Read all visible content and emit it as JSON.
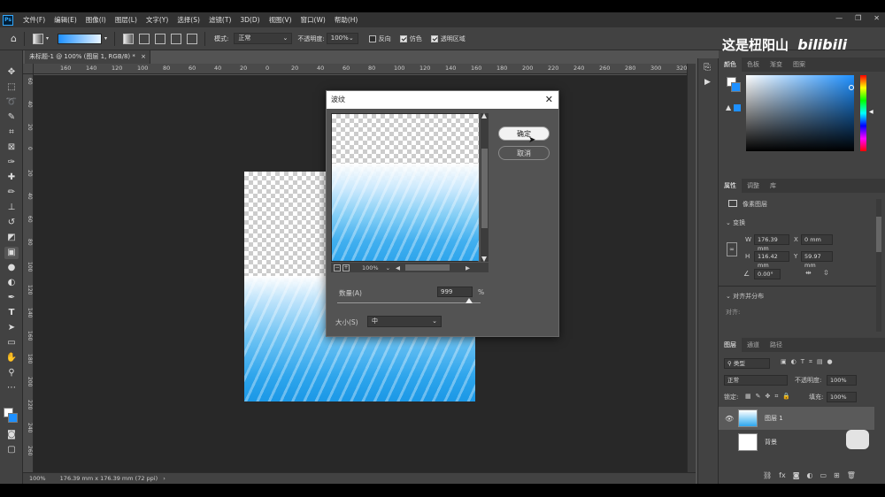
{
  "menubar": {
    "logo": "Ps",
    "items": [
      "文件(F)",
      "编辑(E)",
      "图像(I)",
      "图层(L)",
      "文字(Y)",
      "选择(S)",
      "滤镜(T)",
      "3D(D)",
      "视图(V)",
      "窗口(W)",
      "帮助(H)"
    ],
    "window_controls": [
      "—",
      "❐",
      "✕"
    ]
  },
  "optionsbar": {
    "mode_label": "模式:",
    "mode_value": "正常",
    "opacity_label": "不透明度:",
    "opacity_value": "100%",
    "reverse_label": "反向",
    "dither_label": "仿色",
    "transparency_label": "透明区域",
    "reverse_checked": false,
    "dither_checked": true,
    "transparency_checked": true
  },
  "document": {
    "tab_title": "未标题-1 @ 100% (图层 1, RGB/8) *",
    "tab_close": "×",
    "ruler_top_labels": [
      "160",
      "140",
      "120",
      "100",
      "80",
      "60",
      "40",
      "20",
      "0",
      "20",
      "40",
      "60",
      "80",
      "100",
      "120",
      "140",
      "160",
      "180",
      "200",
      "220",
      "240",
      "260",
      "280",
      "300",
      "320"
    ],
    "ruler_left_labels": [
      "60",
      "40",
      "20",
      "0",
      "20",
      "40",
      "60",
      "80",
      "100",
      "120",
      "140",
      "160",
      "180",
      "200",
      "220",
      "240",
      "260"
    ]
  },
  "statusbar": {
    "zoom": "100%",
    "info": "176.39 mm x 176.39 mm (72 ppi)",
    "arrow": "›"
  },
  "dialog": {
    "title": "波纹",
    "close": "✕",
    "ok_label": "确定",
    "cancel_label": "取消",
    "preview_zoom": "100%",
    "amount_label": "数量(A)",
    "amount_value": "999",
    "amount_unit": "%",
    "size_label": "大小(S)",
    "size_value": "中"
  },
  "watermark": {
    "text": "这是杻阳山",
    "brand": "bilibili"
  },
  "color_panel": {
    "tabs": [
      "颜色",
      "色板",
      "渐变",
      "图案"
    ],
    "fg_color": "#ffffff",
    "bg_color": "#1e90ff"
  },
  "properties_panel": {
    "tabs": [
      "属性",
      "调整",
      "库"
    ],
    "pixel_layer_label": "像素图层",
    "transform_header": "变换",
    "w_label": "W",
    "w_value": "176.39 mm",
    "x_label": "X",
    "x_value": "0 mm",
    "h_label": "H",
    "h_value": "116.42 mm",
    "y_label": "Y",
    "y_value": "59.97 mm",
    "angle_value": "0.00°",
    "align_header": "对齐并分布",
    "align_label": "对齐:"
  },
  "layers_panel": {
    "tabs": [
      "图层",
      "通道",
      "路径"
    ],
    "filter_value": "类型",
    "blend_value": "正常",
    "opacity_label": "不透明度:",
    "opacity_value": "100%",
    "lock_label": "锁定:",
    "fill_label": "填充:",
    "fill_value": "100%",
    "layers": [
      {
        "name": "图层 1",
        "visible": true,
        "selected": true
      },
      {
        "name": "背景",
        "visible": false,
        "selected": false
      }
    ],
    "footer_icons": [
      "link-icon",
      "fx-icon",
      "mask-icon",
      "adjustment-icon",
      "group-icon",
      "new-layer-icon",
      "trash-icon"
    ],
    "footer_fx_label": "fx"
  },
  "tools": [
    "move-icon",
    "marquee-icon",
    "lasso-icon",
    "quick-select-icon",
    "crop-icon",
    "frame-icon",
    "eyedropper-icon",
    "healing-icon",
    "brush-icon",
    "stamp-icon",
    "history-brush-icon",
    "eraser-icon",
    "gradient-icon",
    "blur-icon",
    "dodge-icon",
    "pen-icon",
    "type-icon",
    "path-select-icon",
    "rectangle-icon",
    "hand-icon",
    "zoom-icon",
    "more-icon"
  ]
}
